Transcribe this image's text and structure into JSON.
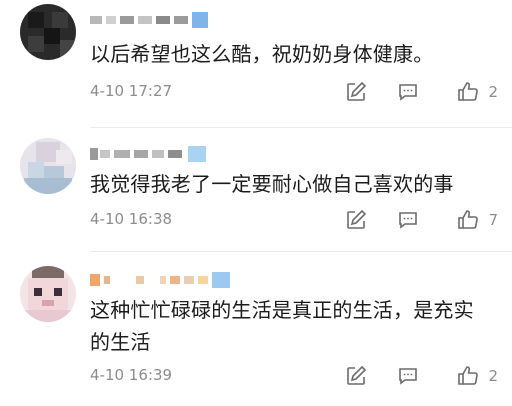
{
  "comments": [
    {
      "text": "以后希望也这么酷，祝奶奶身体健康。",
      "time": "4-10 17:27",
      "likes": "2",
      "actions": {
        "reply_icon": "edit-reply-icon",
        "comment_icon": "comment-bubble-icon",
        "like_icon": "thumbs-up-icon"
      }
    },
    {
      "text": "我觉得我老了一定要耐心做自己喜欢的事",
      "time": "4-10 16:38",
      "likes": "7",
      "actions": {
        "reply_icon": "edit-reply-icon",
        "comment_icon": "comment-bubble-icon",
        "like_icon": "thumbs-up-icon"
      }
    },
    {
      "text": "这种忙忙碌碌的生活是真正的生活，是充实的生活",
      "time": "4-10 16:39",
      "likes": "2",
      "actions": {
        "reply_icon": "edit-reply-icon",
        "comment_icon": "comment-bubble-icon",
        "like_icon": "thumbs-up-icon"
      }
    }
  ],
  "colors": {
    "text": "#1b1b1b",
    "meta": "#8c8c8c",
    "divider": "#ececec"
  }
}
